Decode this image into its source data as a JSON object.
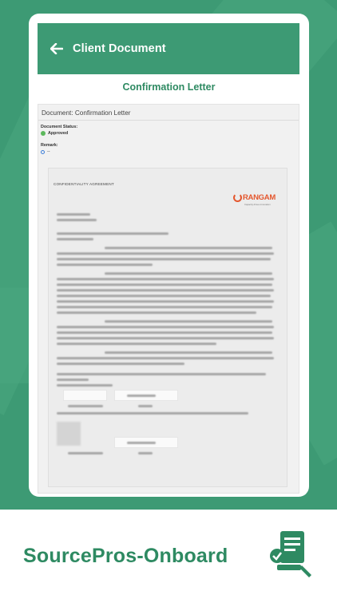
{
  "app": {
    "header_title": "Client Document",
    "document_heading": "Confirmation Letter",
    "panel_title": "Document: Confirmation Letter",
    "status_label": "Document Status:",
    "status_value": "Approved",
    "remark_label": "Remark:",
    "remark_value": "--"
  },
  "letter": {
    "heading": "CONFIDENTIALITY AGREEMENT",
    "logo_text": "RANGAM",
    "logo_tagline": "Capacity drives innovation"
  },
  "footer": {
    "brand": "SourcePros-Onboard"
  },
  "colors": {
    "primary": "#3d9a74",
    "brand_text": "#2e8a62",
    "approved": "#5cb85c",
    "logo": "#e4572e"
  }
}
